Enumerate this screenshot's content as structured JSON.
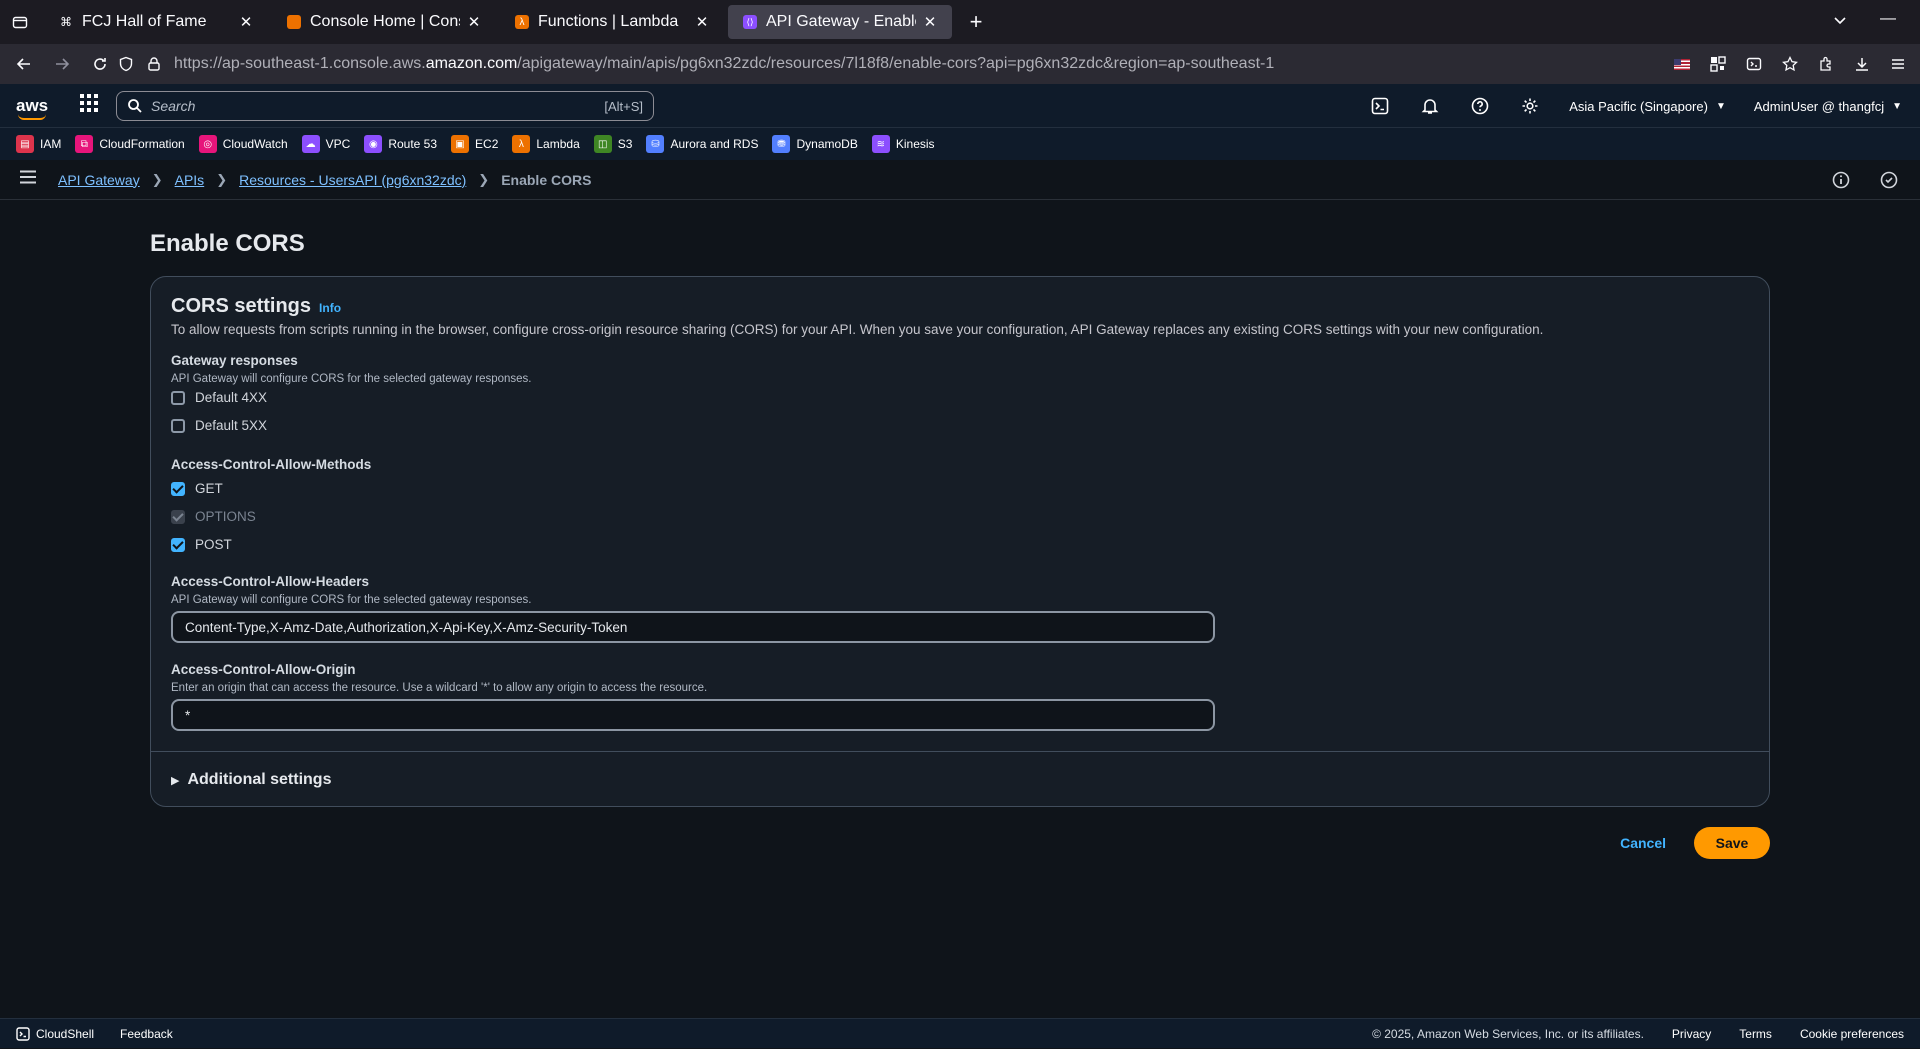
{
  "browser": {
    "tabs": [
      {
        "title": "FCJ Hall of Fame",
        "favicon": "command-icon",
        "active": false
      },
      {
        "title": "Console Home | Console",
        "favicon": "aws-console-icon",
        "active": false
      },
      {
        "title": "Functions | Lambda",
        "favicon": "lambda-icon",
        "active": false
      },
      {
        "title": "API Gateway - Enable CORS",
        "favicon": "api-gateway-icon",
        "active": true
      }
    ],
    "url": {
      "prefix": "https://ap-southeast-1.console.aws.",
      "domain": "amazon.com",
      "path": "/apigateway/main/apis/pg6xn32zdc/resources/7l18f8/enable-cors?api=pg6xn32zdc&region=ap-southeast-1"
    }
  },
  "aws_nav": {
    "search_placeholder": "Search",
    "search_shortcut": "[Alt+S]",
    "region": "Asia Pacific (Singapore)",
    "account": "AdminUser @ thangfcj"
  },
  "favorites": [
    {
      "label": "IAM",
      "color": "#dd344c"
    },
    {
      "label": "CloudFormation",
      "color": "#e7157b"
    },
    {
      "label": "CloudWatch",
      "color": "#e7157b"
    },
    {
      "label": "VPC",
      "color": "#8c4fff"
    },
    {
      "label": "Route 53",
      "color": "#8c4fff"
    },
    {
      "label": "EC2",
      "color": "#ed7100"
    },
    {
      "label": "Lambda",
      "color": "#ed7100"
    },
    {
      "label": "S3",
      "color": "#3f8624"
    },
    {
      "label": "Aurora and RDS",
      "color": "#527fff"
    },
    {
      "label": "DynamoDB",
      "color": "#527fff"
    },
    {
      "label": "Kinesis",
      "color": "#8c4fff"
    }
  ],
  "breadcrumb": {
    "items": [
      "API Gateway",
      "APIs",
      "Resources - UsersAPI (pg6xn32zdc)"
    ],
    "current": "Enable CORS"
  },
  "page": {
    "title": "Enable CORS",
    "card_title": "CORS settings",
    "info_label": "Info",
    "description": "To allow requests from scripts running in the browser, configure cross-origin resource sharing (CORS) for your API. When you save your configuration, API Gateway replaces any existing CORS settings with your new configuration.",
    "gateway_responses": {
      "label": "Gateway responses",
      "sub": "API Gateway will configure CORS for the selected gateway responses.",
      "options": [
        {
          "label": "Default 4XX",
          "checked": false
        },
        {
          "label": "Default 5XX",
          "checked": false
        }
      ]
    },
    "methods": {
      "label": "Access-Control-Allow-Methods",
      "options": [
        {
          "label": "GET",
          "checked": true,
          "disabled": false
        },
        {
          "label": "OPTIONS",
          "checked": true,
          "disabled": true
        },
        {
          "label": "POST",
          "checked": true,
          "disabled": false
        }
      ]
    },
    "headers": {
      "label": "Access-Control-Allow-Headers",
      "sub": "API Gateway will configure CORS for the selected gateway responses.",
      "value": "Content-Type,X-Amz-Date,Authorization,X-Api-Key,X-Amz-Security-Token"
    },
    "origin": {
      "label": "Access-Control-Allow-Origin",
      "sub": "Enter an origin that can access the resource. Use a wildcard '*' to allow any origin to access the resource.",
      "value": "*"
    },
    "additional_settings": "Additional settings",
    "cancel_label": "Cancel",
    "save_label": "Save"
  },
  "footer": {
    "cloudshell": "CloudShell",
    "feedback": "Feedback",
    "copyright": "© 2025, Amazon Web Services, Inc. or its affiliates.",
    "privacy": "Privacy",
    "terms": "Terms",
    "cookies": "Cookie preferences"
  }
}
